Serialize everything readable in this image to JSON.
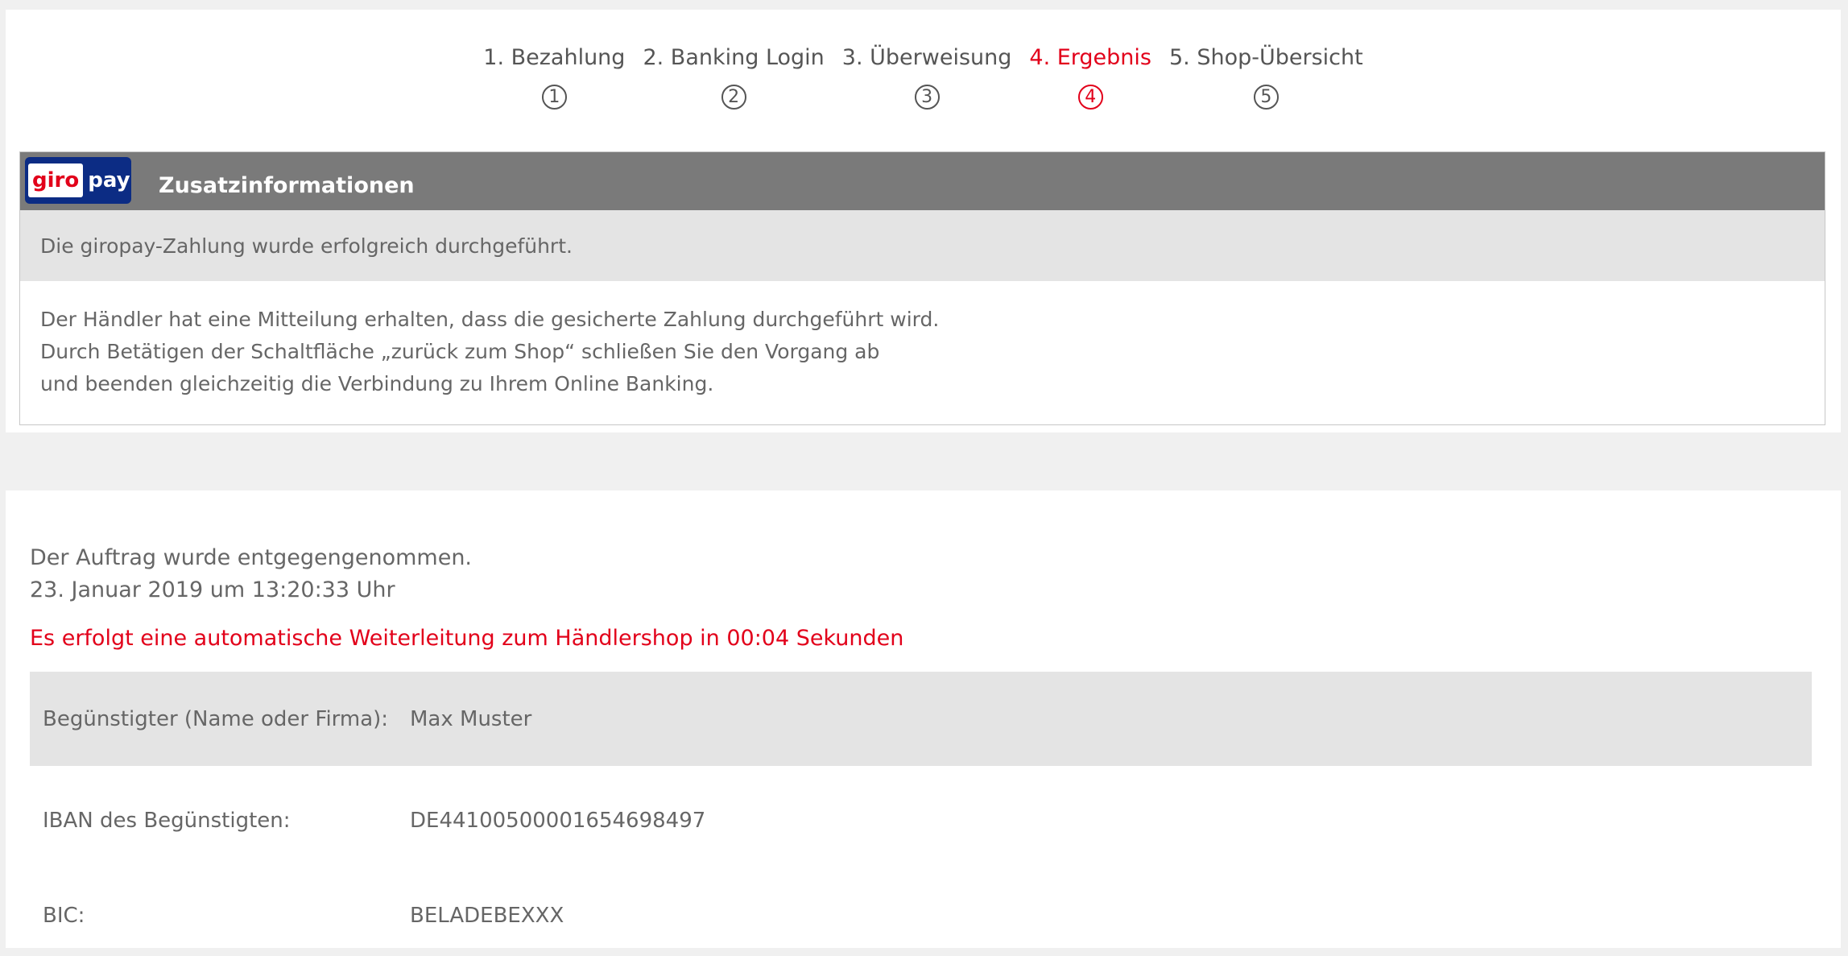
{
  "steps": [
    {
      "label": "1. Bezahlung",
      "num": "1",
      "active": false
    },
    {
      "label": "2. Banking Login",
      "num": "2",
      "active": false
    },
    {
      "label": "3. Überweisung",
      "num": "3",
      "active": false
    },
    {
      "label": "4. Ergebnis",
      "num": "4",
      "active": true
    },
    {
      "label": "5. Shop-Übersicht",
      "num": "5",
      "active": false
    }
  ],
  "info": {
    "logo_giro": "giro",
    "logo_pay": "pay",
    "title": "Zusatzinformationen",
    "status": "Die giropay-Zahlung wurde erfolgreich durchgeführt.",
    "body_lines": [
      "Der Händler hat eine Mitteilung erhalten, dass die gesicherte Zahlung durchgeführt wird.",
      "Durch Betätigen der Schaltfläche „zurück zum Shop“ schließen Sie den Vorgang ab",
      "und beenden gleichzeitig die Verbindung zu Ihrem Online Banking."
    ]
  },
  "order": {
    "accepted": "Der Auftrag wurde entgegengenommen.",
    "timestamp": "23. Januar 2019 um 13:20:33 Uhr",
    "redirect": "Es erfolgt eine automatische Weiterleitung zum Händlershop in 00:04 Sekunden"
  },
  "details": [
    {
      "label": "Begünstigter (Name oder Firma):",
      "value": "Max Muster"
    },
    {
      "label": "IBAN des Begünstigten:",
      "value": "DE44100500001654698497"
    },
    {
      "label": "BIC:",
      "value": "BELADEBEXXX"
    }
  ],
  "colors": {
    "accent_red": "#e2001a",
    "header_gray": "#7a7a7a",
    "shade_gray": "#e4e4e4",
    "giropay_blue": "#0c2c84"
  }
}
